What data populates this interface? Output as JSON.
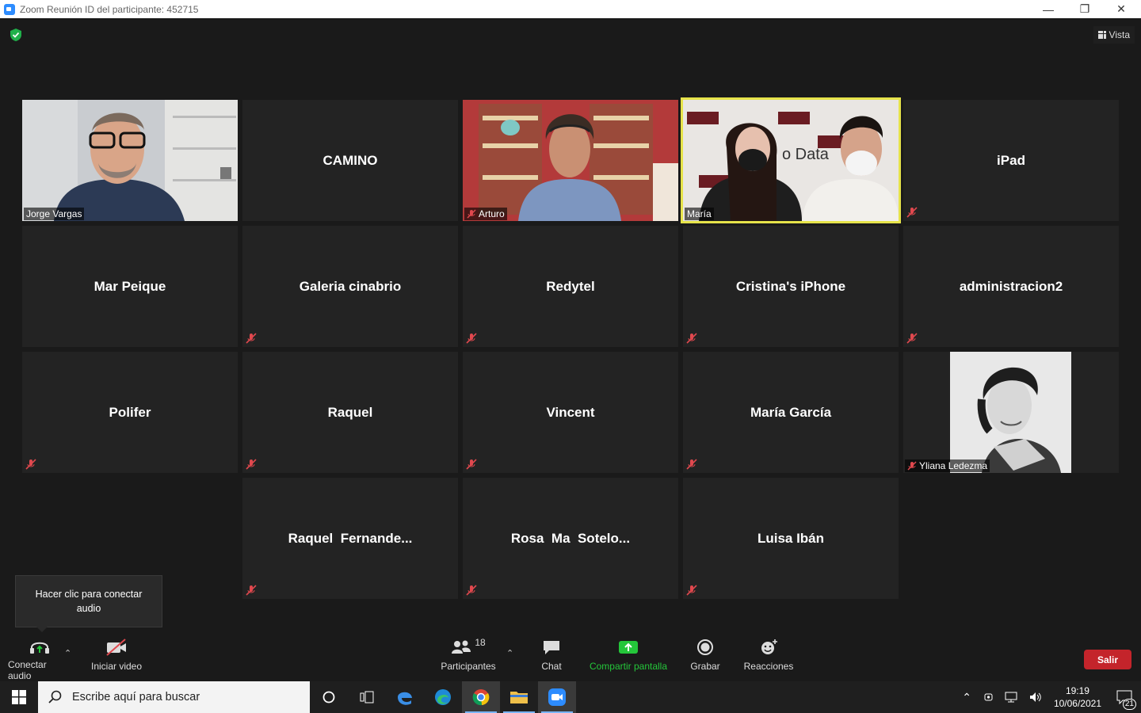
{
  "window": {
    "title": "Zoom Reunión ID del participante: 452715",
    "minimize": "—",
    "restore": "❐",
    "close": "✕"
  },
  "view_button": {
    "label": "Vista"
  },
  "participants": [
    {
      "name": "Jorge Vargas",
      "video": true
    },
    {
      "name": "CAMINO",
      "video": false,
      "muted": false
    },
    {
      "name": "Arturo",
      "video": true,
      "muted": true
    },
    {
      "name": "María",
      "video": true,
      "active_speaker": true
    },
    {
      "name": "iPad",
      "video": false,
      "muted": true
    },
    {
      "name": "Mar Peique",
      "video": false,
      "muted": false
    },
    {
      "name": "Galeria cinabrio",
      "video": false,
      "muted": true
    },
    {
      "name": "Redytel",
      "video": false,
      "muted": true
    },
    {
      "name": "Cristina's iPhone",
      "video": false,
      "muted": true
    },
    {
      "name": "administracion2",
      "video": false,
      "muted": true
    },
    {
      "name": "Polifer",
      "video": false,
      "muted": true
    },
    {
      "name": "Raquel",
      "video": false,
      "muted": true
    },
    {
      "name": "Vincent",
      "video": false,
      "muted": true
    },
    {
      "name": "María García",
      "video": false,
      "muted": true
    },
    {
      "name": "Yliana Ledezma",
      "video": true,
      "muted": true
    },
    {
      "name": "Raquel  Fernande...",
      "video": false,
      "muted": true
    },
    {
      "name": "Rosa  Ma  Sotelo...",
      "video": false,
      "muted": true
    },
    {
      "name": "Luisa Ibán",
      "video": false,
      "muted": true
    }
  ],
  "tooltip": {
    "text": "Hacer clic para conectar audio"
  },
  "toolbar": {
    "audio": "Conectar audio",
    "video": "Iniciar video",
    "participants": "Participantes",
    "participants_count": "18",
    "chat": "Chat",
    "share": "Compartir pantalla",
    "record": "Grabar",
    "reactions": "Reacciones",
    "leave": "Salir"
  },
  "taskbar": {
    "search_placeholder": "Escribe aquí para buscar",
    "time": "19:19",
    "date": "10/06/2021",
    "notifications": "21"
  },
  "colors": {
    "active_speaker": "#e6e34a",
    "leave": "#c4242b",
    "share": "#24c63a",
    "mute": "#e0484e"
  }
}
